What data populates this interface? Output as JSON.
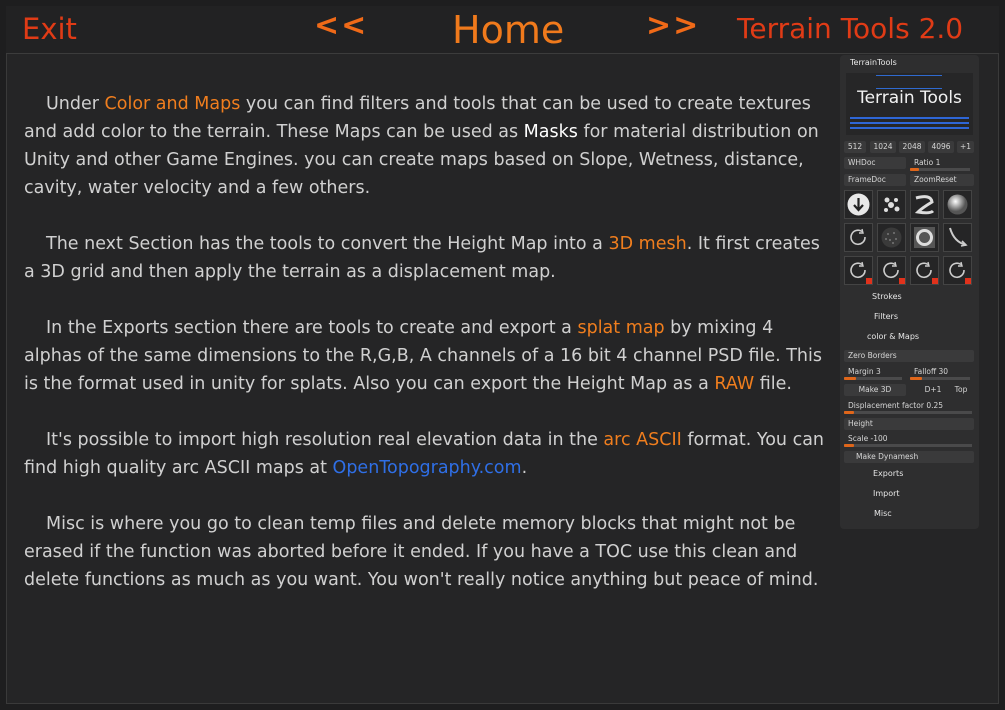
{
  "header": {
    "exit": "Exit",
    "prev": "<<",
    "title": "Home",
    "next": ">>",
    "brand": "Terrain Tools 2.0"
  },
  "content": {
    "p1": {
      "a": "Under ",
      "b": "Color and Maps",
      "c": " you can find filters and tools that can be used to create textures and add color to the terrain. These Maps can be used as ",
      "d": "Masks",
      "e": " for material distribution on Unity and other Game Engines. you can create maps based on Slope, Wetness, distance, cavity, water velocity and a few others."
    },
    "p2": {
      "a": "The next Section has the tools to convert the Height Map into  a ",
      "b": "3D mesh",
      "c": ". It first creates a 3D grid and then apply the terrain as a displacement map."
    },
    "p3": {
      "a": "In the Exports section there are tools to create and export a ",
      "b": "splat map",
      "c": " by mixing 4 alphas of the same dimensions to the R,G,B, A channels of a 16 bit 4 channel PSD file. This is the format used in unity for splats. Also you can export the Height Map as a ",
      "d": "RAW",
      "e": " file."
    },
    "p4": {
      "a": "It's possible to import high resolution real elevation data in the ",
      "b": "arc ASCII",
      "c": " format. You can find high quality arc ASCII maps at ",
      "d": "OpenTopography.com",
      "e": "."
    },
    "p5": {
      "a": "Misc is where you go to clean temp files and delete memory blocks that might not be erased if the function was aborted before it ended. If you have a TOC use this clean and delete functions as much as you want. You won't really  notice anything but peace of mind."
    }
  },
  "panel": {
    "title": "TerrainTools",
    "logo_text": "Terrain Tools",
    "sizes": [
      "512",
      "1024",
      "2048",
      "4096",
      "+1"
    ],
    "whdoc": "WHDoc",
    "ratio": "Ratio 1",
    "ratio_value": 0.15,
    "framedoc": "FrameDoc",
    "zoomreset": "ZoomReset",
    "strokes": "Strokes",
    "filters": "Filters",
    "color_maps": "color & Maps",
    "zero_borders": "Zero Borders",
    "margin": "Margin 3",
    "margin_value": 0.2,
    "falloff": "Falloff 30",
    "falloff_value": 0.2,
    "make3d": "Make 3D",
    "d1": "D+1",
    "top": "Top",
    "displacement": "Displacement factor",
    "displacement_val": "0.25",
    "displacement_value": 0.08,
    "height": "Height",
    "scale": "Scale -100",
    "scale_value": 0.08,
    "make_dynamesh": "Make Dynamesh",
    "exports": "Exports",
    "import": "Import",
    "misc": "Misc",
    "colors": {
      "accent": "#e0661a",
      "blue": "#2e66d6",
      "red": "#e0321c"
    }
  }
}
